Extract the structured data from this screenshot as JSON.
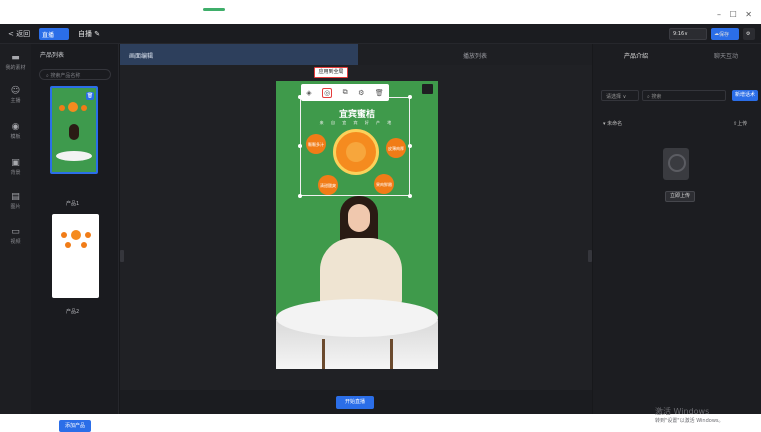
{
  "window": {
    "controls": "– ☐ ✕"
  },
  "header": {
    "back_label": "< 返回",
    "badge_label": "直播",
    "project_name": "自播",
    "ratio_label": "9:16",
    "save_label": "保存"
  },
  "rail": {
    "items": [
      {
        "label": "我的素材",
        "icon": "folder-icon"
      },
      {
        "label": "主播",
        "icon": "person-icon"
      },
      {
        "label": "模板",
        "icon": "palette-icon"
      },
      {
        "label": "背景",
        "icon": "image-icon"
      },
      {
        "label": "图片",
        "icon": "picture-icon"
      },
      {
        "label": "视频",
        "icon": "video-icon"
      }
    ]
  },
  "product_list": {
    "title": "产品列表",
    "search_placeholder": "搜索产品名称",
    "items": [
      {
        "label": "产品1"
      },
      {
        "label": "产品2"
      }
    ],
    "add_button": "添加产品"
  },
  "center": {
    "tabs": [
      {
        "label": "画面编辑"
      },
      {
        "label": "播放列表"
      }
    ],
    "apply_tip": "应用到全局",
    "canvas": {
      "title": "宜宾蜜桔",
      "subtitle": "来 自 宜 宾 好 产 地",
      "bubbles": [
        "颗颗多汁",
        "皮薄肉厚",
        "清甜酸爽",
        "果肉鲜嫩"
      ]
    },
    "start_button": "开始直播"
  },
  "right": {
    "tabs": [
      {
        "label": "产品介绍"
      },
      {
        "label": "聊天互动"
      }
    ],
    "select_label": "请选择 ∨",
    "search_placeholder": "搜索",
    "new_button": "新增话术",
    "unnamed": "▾ 未命名",
    "upload_top": "⇪上传",
    "local_upload": "立即上传",
    "watermark_title": "激活 Windows",
    "watermark_sub": "转到\"设置\"以激活 Windows。"
  },
  "colors": {
    "accent": "#2b6ee8",
    "canvas_green": "#3f9a4b",
    "orange": "#f58b1f",
    "highlight_red": "#e43c3c"
  }
}
